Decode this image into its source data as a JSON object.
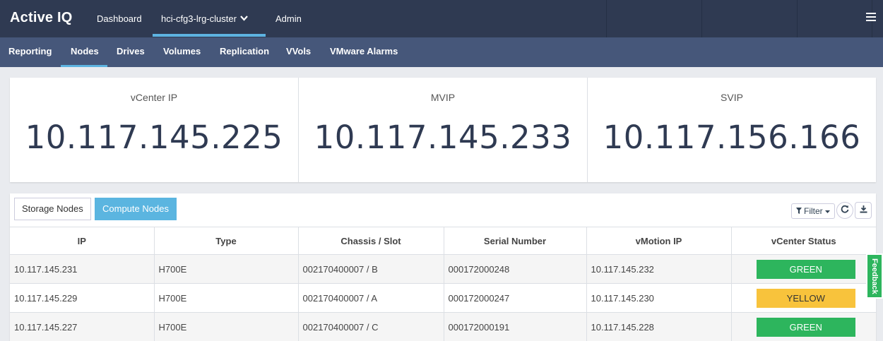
{
  "app": {
    "title": "Active IQ"
  },
  "topnav": {
    "dashboard": "Dashboard",
    "cluster": "hci-cfg3-lrg-cluster",
    "admin": "Admin"
  },
  "subnav": {
    "items": [
      {
        "label": "Reporting"
      },
      {
        "label": "Nodes"
      },
      {
        "label": "Drives"
      },
      {
        "label": "Volumes"
      },
      {
        "label": "Replication"
      },
      {
        "label": "VVols"
      },
      {
        "label": "VMware Alarms"
      }
    ],
    "active": "Nodes"
  },
  "ips": [
    {
      "label": "vCenter IP",
      "value": "10.117.145.225"
    },
    {
      "label": "MVIP",
      "value": "10.117.145.233"
    },
    {
      "label": "SVIP",
      "value": "10.117.156.166"
    }
  ],
  "table": {
    "tabs": {
      "storage": "Storage Nodes",
      "compute": "Compute Nodes"
    },
    "filter_label": "Filter",
    "columns": [
      "IP",
      "Type",
      "Chassis / Slot",
      "Serial Number",
      "vMotion IP",
      "vCenter Status"
    ],
    "rows": [
      {
        "ip": "10.117.145.231",
        "type": "H700E",
        "chassis": "002170400007 / B",
        "serial": "000172000248",
        "vmotion": "10.117.145.232",
        "status": "GREEN"
      },
      {
        "ip": "10.117.145.229",
        "type": "H700E",
        "chassis": "002170400007 / A",
        "serial": "000172000247",
        "vmotion": "10.117.145.230",
        "status": "YELLOW"
      },
      {
        "ip": "10.117.145.227",
        "type": "H700E",
        "chassis": "002170400007 / C",
        "serial": "000172000191",
        "vmotion": "10.117.145.228",
        "status": "GREEN"
      }
    ]
  },
  "feedback": "Feedback",
  "colors": {
    "topbar": "#2f3a52",
    "subbar": "#46577a",
    "accent": "#5db3e1",
    "green": "#2db55d",
    "yellow": "#f8c33c"
  },
  "icons": [
    "chevron-down-icon",
    "hamburger-icon",
    "filter-icon",
    "caret-down-icon",
    "refresh-icon",
    "download-icon"
  ]
}
